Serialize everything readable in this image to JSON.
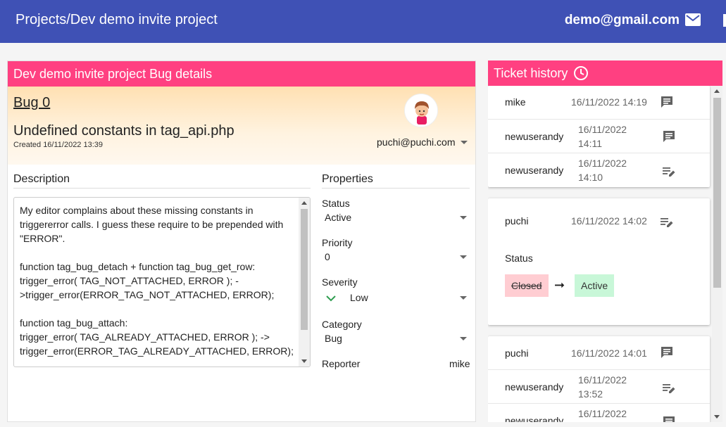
{
  "header": {
    "title": "Projects/Dev demo invite project",
    "user_email": "demo@gmail.com"
  },
  "bug_panel": {
    "title": "Dev demo invite project Bug details",
    "bug_id": "Bug 0",
    "bug_title": "Undefined constants in tag_api.php",
    "created": "Created 16/11/2022 13:39",
    "assignee": "puchi@puchi.com",
    "description_label": "Description",
    "description": "My editor complains about these missing constants in triggererror calls. I guess these require to be prepended with \"ERROR\".\n\nfunction tag_bug_detach + function tag_bug_get_row:\ntrigger_error( TAG_NOT_ATTACHED, ERROR ); ->trigger_error(ERROR_TAG_NOT_ATTACHED, ERROR);\n\nfunction tag_bug_attach:\ntrigger_error( TAG_ALREADY_ATTACHED, ERROR ); ->\ntrigger_error(ERROR_TAG_ALREADY_ATTACHED, ERROR);",
    "properties_label": "Properties",
    "properties": {
      "status_label": "Status",
      "status_value": "Active",
      "priority_label": "Priority",
      "priority_value": "0",
      "severity_label": "Severity",
      "severity_value": "Low",
      "category_label": "Category",
      "category_value": "Bug",
      "reporter_label": "Reporter",
      "reporter_value": "mike"
    }
  },
  "history": {
    "title": "Ticket history",
    "card1": [
      {
        "user": "mike",
        "time": "16/11/2022 14:19",
        "icon": "comment-icon"
      },
      {
        "user": "newuserandy",
        "time": "16/11/2022 14:11",
        "icon": "comment-icon"
      },
      {
        "user": "newuserandy",
        "time": "16/11/2022 14:10",
        "icon": "edit-note-icon"
      }
    ],
    "card2": {
      "user": "puchi",
      "time": "16/11/2022 14:02",
      "icon": "edit-note-icon",
      "field": "Status",
      "old_value": "Closed",
      "new_value": "Active"
    },
    "card3": [
      {
        "user": "puchi",
        "time": "16/11/2022 14:01",
        "icon": "comment-icon"
      },
      {
        "user": "newuserandy",
        "time": "16/11/2022 13:52",
        "icon": "edit-note-icon"
      },
      {
        "user": "newuserandy",
        "time": "16/11/2022",
        "icon": "comment-icon"
      }
    ]
  },
  "colors": {
    "topbar": "#3f51b5",
    "accent": "#ff4081",
    "chip_old": "#ffcdd2",
    "chip_new": "#c8f7d8"
  }
}
